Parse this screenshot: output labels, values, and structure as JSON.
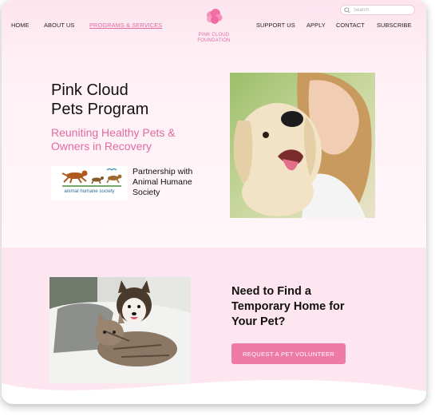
{
  "search": {
    "placeholder": "Search"
  },
  "nav": {
    "home": "HOME",
    "about": "ABOUT US",
    "programs": "PROGRAMS & SERVICES",
    "support": "SUPPORT US",
    "apply": "APPLY",
    "contact": "CONTACT",
    "subscribe": "SUBSCRIBE"
  },
  "logo": {
    "text": "PINK CLOUD\nFOUNDATION"
  },
  "hero": {
    "title": "Pink Cloud\nPets Program",
    "subtitle": "Reuniting Healthy Pets &\nOwners in Recovery",
    "partner_logo_text": "animal humane society",
    "partner_text": "Partnership with\nAnimal Humane\nSociety"
  },
  "section2": {
    "heading": "Need to Find a\nTemporary Home for\nYour Pet?",
    "cta_label": "REQUEST A PET VOLUNTEER"
  },
  "colors": {
    "accent": "#e06aa0",
    "button": "#ee7aa6",
    "section_bg": "#fde6ef"
  },
  "icons": [
    "search-icon",
    "cloud-logo-icon"
  ]
}
